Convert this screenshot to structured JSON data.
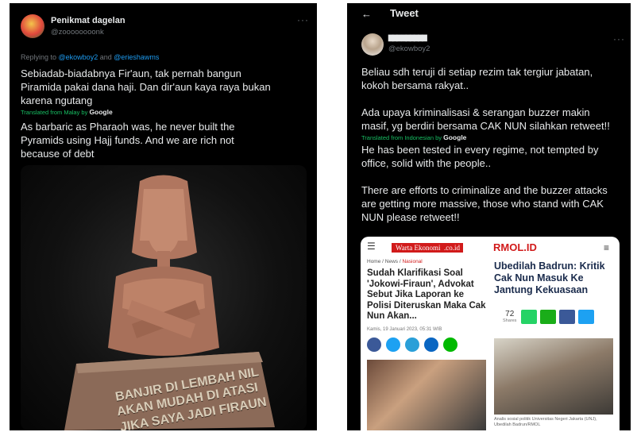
{
  "left_tweet": {
    "author_name": "Penikmat dagelan",
    "author_handle": "@zoooooooonk",
    "more": "···",
    "replying_prefix": "Replying to ",
    "replying_user1": "@ekowboy2",
    "replying_and": " and ",
    "replying_user2": "@erieshawms",
    "text_lines": [
      "Sebiadab-biadabnya Fir'aun, tak pernah bangun",
      "Piramida pakai dana haji. Dan dir'aun kaya raya bukan",
      "karena ngutang"
    ],
    "translated_from": "Translated from Malay by",
    "translator": "Google",
    "translation_lines": [
      "As barbaric as Pharaoh was, he never built the",
      "Pyramids using Hajj funds. And we are rich not",
      "because of debt"
    ],
    "image_text_lines": [
      "BANJIR DI LEMBAH NIL",
      "AKAN MUDAH DI ATASI",
      "JIKA SAYA JADI FIRAUN"
    ]
  },
  "right_tweet": {
    "back_icon": "arrow-left-icon",
    "header_title": "Tweet",
    "author_name": "▇▇▇ ▇▇▇▇▇▇",
    "author_handle": "@ekowboy2",
    "more": "···",
    "text_lines": [
      "Beliau sdh teruji di setiap rezim tak tergiur jabatan,",
      "kokoh bersama rakyat..",
      "",
      "Ada upaya kriminalisasi & serangan buzzer makin",
      "masif, yg berdiri bersama CAK NUN silahkan retweet!!"
    ],
    "translated_from": "Translated from Indonesian by",
    "translator": "Google",
    "translation_lines": [
      "He has been tested in every regime, not tempted by",
      "office, solid with the people..",
      "",
      "There are efforts to criminalize and the buzzer attacks",
      "are getting more massive, those who stand with CAK",
      "NUN please retweet!!"
    ],
    "news": {
      "left_site_logo": "Warta Ekonomi",
      "left_site_logo_tld": ".co.id",
      "breadcrumb_home": "Home",
      "breadcrumb_sep": " / ",
      "breadcrumb_news": "News",
      "breadcrumb_section": "Nasional",
      "left_headline": "Sudah Klarifikasi Soal 'Jokowi-Firaun', Advokat Sebut Jika Laporan ke Polisi Diteruskan Maka Cak Nun Akan...",
      "left_date": "Kamis, 19 Januari 2023, 05:31 WIB",
      "right_site_logo": "RMOL.ID",
      "right_headline": "Ubedilah Badrun: Kritik Cak Nun Masuk Ke Jantung Kekuasaan",
      "share_count": "72",
      "share_label": "Shares",
      "caption": "Analis sosial politik Universitas Negeri Jakarta (UNJ), Ubedilah Badrun/RMOL"
    }
  }
}
